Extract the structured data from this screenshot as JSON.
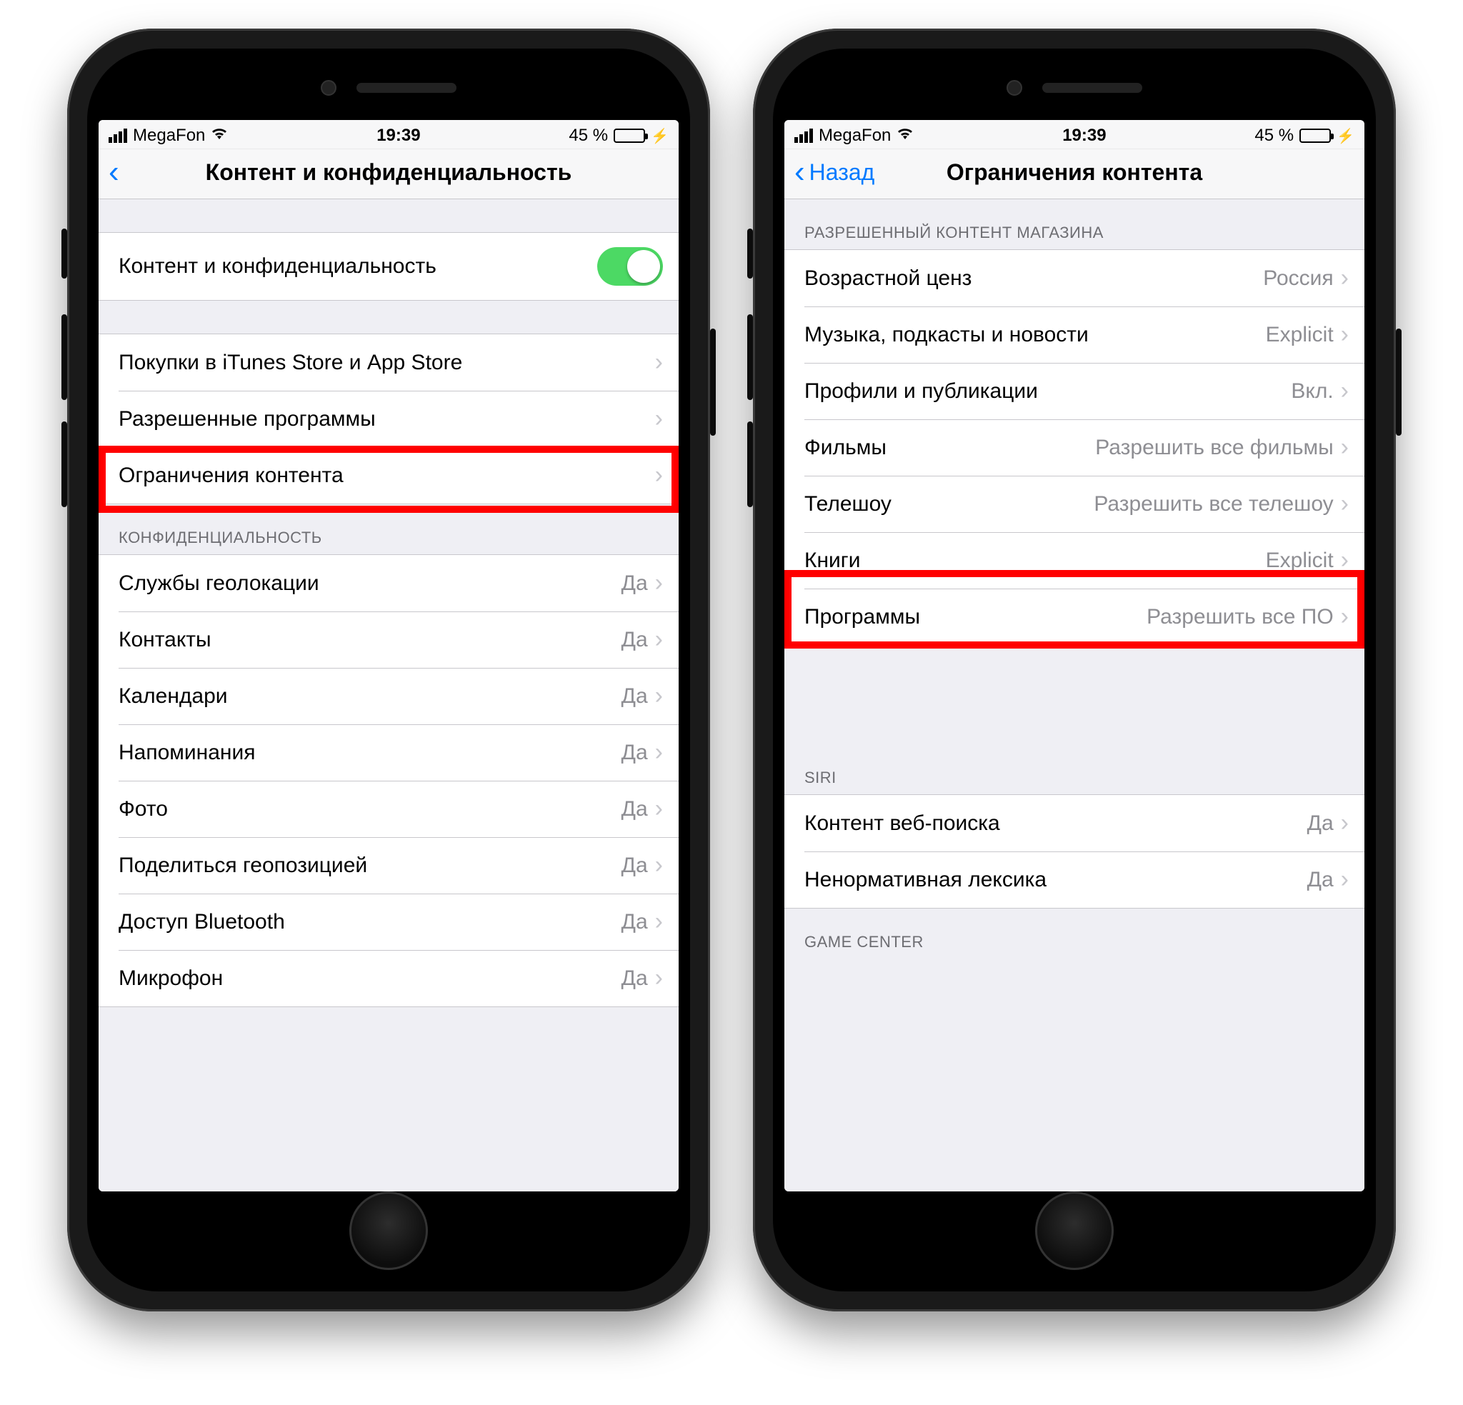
{
  "status": {
    "carrier": "MegaFon",
    "time": "19:39",
    "battery_pct": "45 %"
  },
  "left": {
    "nav_title": "Контент и конфиденциальность",
    "toggle_label": "Контент и конфиденциальность",
    "group1": [
      {
        "label": "Покупки в iTunes Store и App Store"
      },
      {
        "label": "Разрешенные программы"
      },
      {
        "label": "Ограничения контента",
        "highlight": true
      }
    ],
    "group2_header": "КОНФИДЕНЦИАЛЬНОСТЬ",
    "group2": [
      {
        "label": "Службы геолокации",
        "value": "Да"
      },
      {
        "label": "Контакты",
        "value": "Да"
      },
      {
        "label": "Календари",
        "value": "Да"
      },
      {
        "label": "Напоминания",
        "value": "Да"
      },
      {
        "label": "Фото",
        "value": "Да"
      },
      {
        "label": "Поделиться геопозицией",
        "value": "Да"
      },
      {
        "label": "Доступ Bluetooth",
        "value": "Да"
      },
      {
        "label": "Микрофон",
        "value": "Да"
      }
    ]
  },
  "right": {
    "nav_back": "Назад",
    "nav_title": "Ограничения контента",
    "group1_header": "РАЗРЕШЕННЫЙ КОНТЕНТ МАГАЗИНА",
    "group1": [
      {
        "label": "Возрастной ценз",
        "value": "Россия"
      },
      {
        "label": "Музыка, подкасты и новости",
        "value": "Explicit"
      },
      {
        "label": "Профили и публикации",
        "value": "Вкл."
      },
      {
        "label": "Фильмы",
        "value": "Разрешить все фильмы"
      },
      {
        "label": "Телешоу",
        "value": "Разрешить все телешоу"
      },
      {
        "label": "Книги",
        "value": "Explicit"
      },
      {
        "label": "Программы",
        "value": "Разрешить все ПО",
        "highlight": true
      }
    ],
    "group2_header": "SIRI",
    "group2": [
      {
        "label": "Контент веб-поиска",
        "value": "Да"
      },
      {
        "label": "Ненормативная лексика",
        "value": "Да"
      }
    ],
    "group3_header": "GAME CENTER"
  }
}
